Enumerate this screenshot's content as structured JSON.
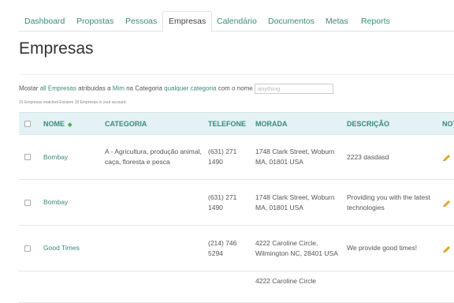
{
  "nav": {
    "tabs": [
      {
        "label": "Dashboard"
      },
      {
        "label": "Propostas"
      },
      {
        "label": "Pessoas"
      },
      {
        "label": "Empresas",
        "active": true
      },
      {
        "label": "Calendário"
      },
      {
        "label": "Documentos"
      },
      {
        "label": "Metas"
      },
      {
        "label": "Reports"
      }
    ]
  },
  "page": {
    "title": "Empresas"
  },
  "filter": {
    "prefix": "Mostar",
    "scope": "all Empresas",
    "assigned_text": "atribuidas a",
    "assignee": "Mim",
    "category_text": "na Categoria",
    "category": "qualquer categoria",
    "name_text": "com o nome",
    "name_placeholder": "anything"
  },
  "summary": "15 Empresas matched Existem 18 Empresas in your account.",
  "table": {
    "columns": {
      "name": "NOME",
      "category": "CATEGORIA",
      "phone": "TELEFONE",
      "address": "MORADA",
      "description": "DESCRIÇÃO",
      "notes": "NOTAS"
    },
    "rows": [
      {
        "name": "Bombay",
        "category": "A - Agricultura, produção animal, caça, floresta e pesca",
        "phone": "(631) 271 1490",
        "address": "1748 Clark Street, Woburn MA, 01801 USA",
        "description": "2223  dasdasd"
      },
      {
        "name": "Bombay",
        "category": "",
        "phone": "(631) 271 1490",
        "address": "1748 Clark Street, Woburn MA, 01801 USA",
        "description": "Providing you with the latest technologies"
      },
      {
        "name": "Good Times",
        "category": "",
        "phone": "(214) 746 5294",
        "address": "4222 Caroline Circle, Wilmington NC, 28401 USA",
        "description": "We provide good times!"
      },
      {
        "name": "",
        "category": "",
        "phone": "",
        "address": "4222 Caroline Circle",
        "description": ""
      }
    ]
  },
  "colors": {
    "accent": "#3a8a7a",
    "header_bg": "#e4f1f5",
    "edit_icon": "#e8a317"
  }
}
